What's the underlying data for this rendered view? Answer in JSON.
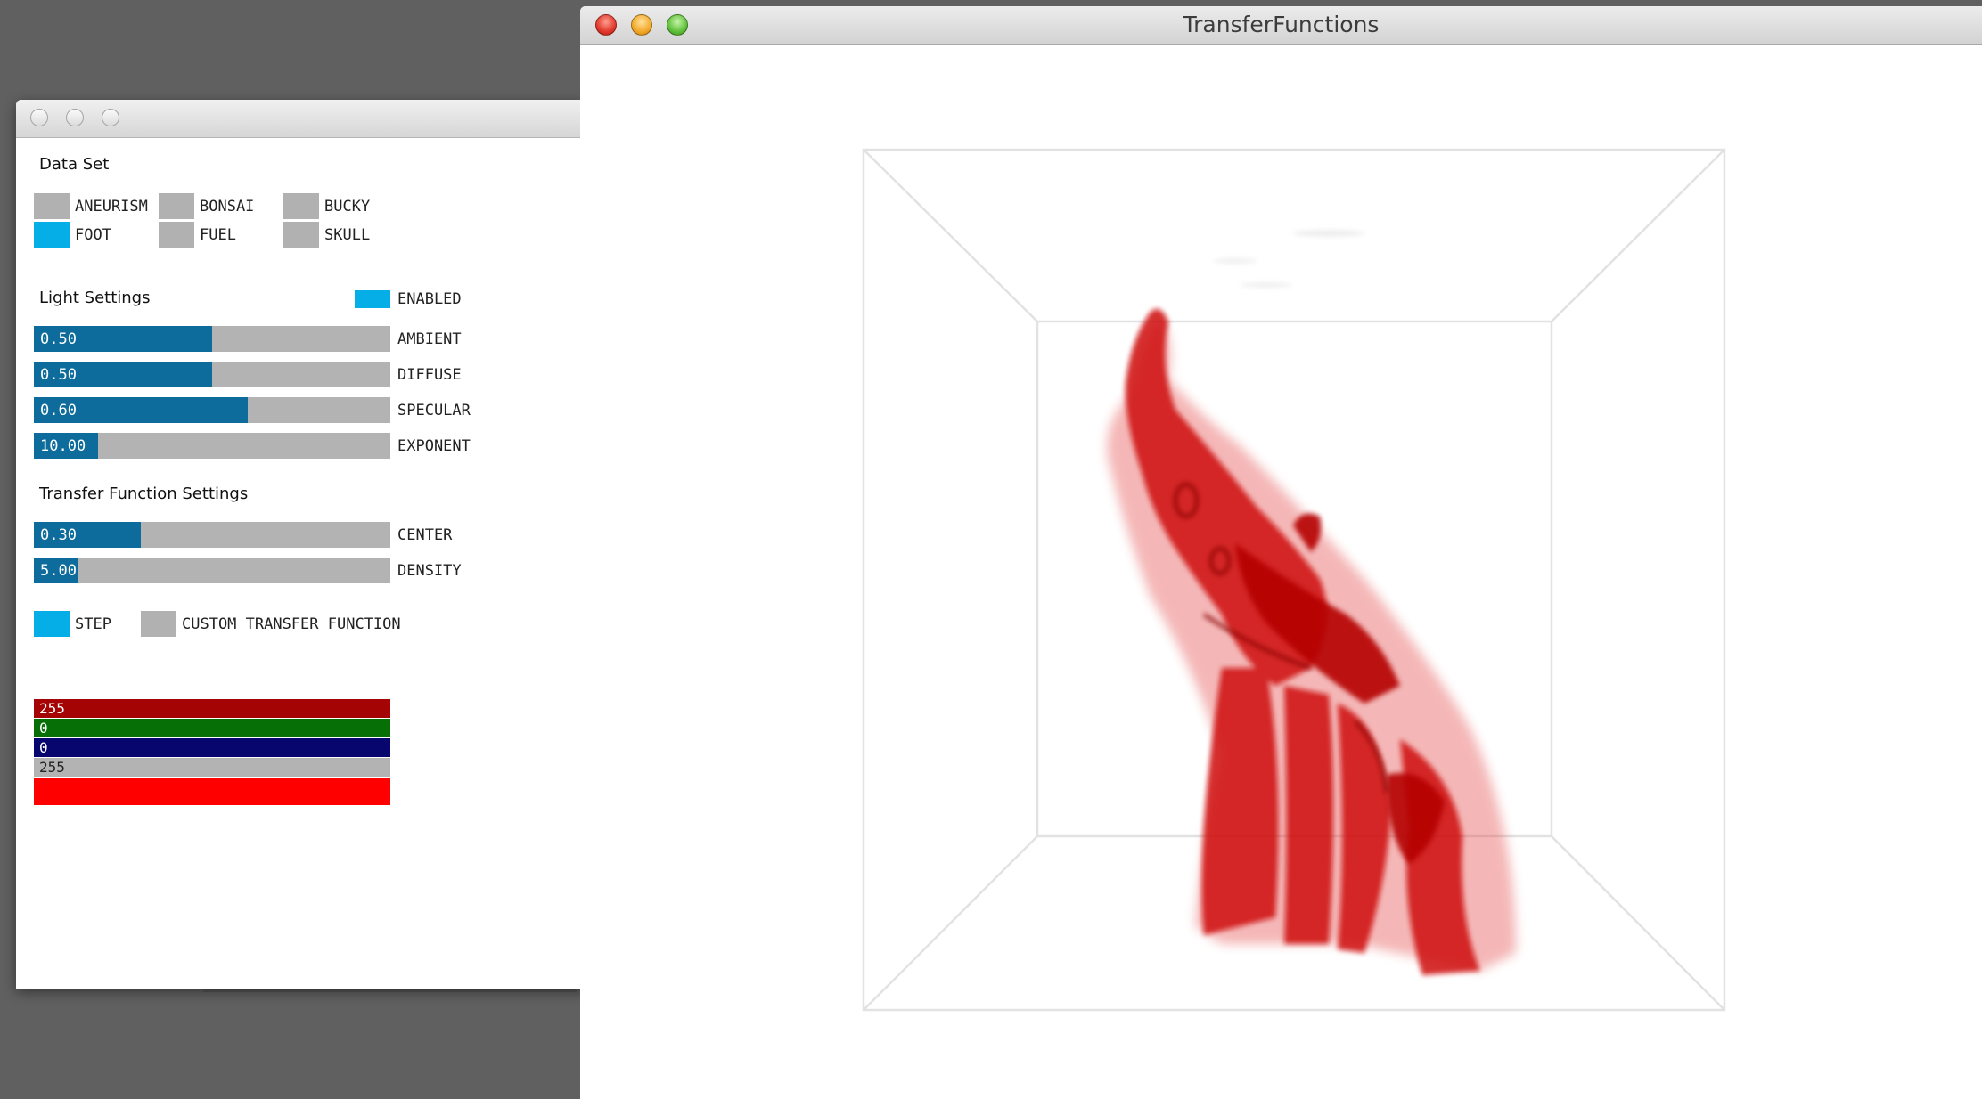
{
  "main_window": {
    "title": "TransferFunctions"
  },
  "data_set": {
    "heading": "Data Set",
    "options": [
      {
        "label": "ANEURISM",
        "selected": false
      },
      {
        "label": "BONSAI",
        "selected": false
      },
      {
        "label": "BUCKY",
        "selected": false
      },
      {
        "label": "FOOT",
        "selected": true
      },
      {
        "label": "FUEL",
        "selected": false
      },
      {
        "label": "SKULL",
        "selected": false
      }
    ]
  },
  "light_settings": {
    "heading": "Light Settings",
    "enabled": {
      "label": "ENABLED",
      "on": true
    },
    "sliders": [
      {
        "label": "AMBIENT",
        "value": "0.50",
        "fraction": 0.5
      },
      {
        "label": "DIFFUSE",
        "value": "0.50",
        "fraction": 0.5
      },
      {
        "label": "SPECULAR",
        "value": "0.60",
        "fraction": 0.6
      },
      {
        "label": "EXPONENT",
        "value": "10.00",
        "fraction": 0.18
      }
    ]
  },
  "transfer_function_settings": {
    "heading": "Transfer Function Settings",
    "sliders": [
      {
        "label": "CENTER",
        "value": "0.30",
        "fraction": 0.3
      },
      {
        "label": "DENSITY",
        "value": "5.00",
        "fraction": 0.125
      }
    ],
    "modes": [
      {
        "label": "STEP",
        "selected": true
      },
      {
        "label": "CUSTOM TRANSFER FUNCTION",
        "selected": false
      }
    ]
  },
  "color_picker": {
    "red": "255",
    "green": "0",
    "blue": "0",
    "alpha": "255"
  },
  "colors": {
    "toggle_on": "#05aee6",
    "toggle_off": "#b1b1b1",
    "slider_fill": "#0d6c9c",
    "red_bar": "#a50404",
    "green_bar": "#067006",
    "blue_bar": "#06066e",
    "alpha_bar": "#b3b3b3",
    "preview": "#ff0000",
    "volume": "#d40000"
  },
  "icons": [
    "close-icon",
    "minimize-icon",
    "zoom-icon"
  ]
}
